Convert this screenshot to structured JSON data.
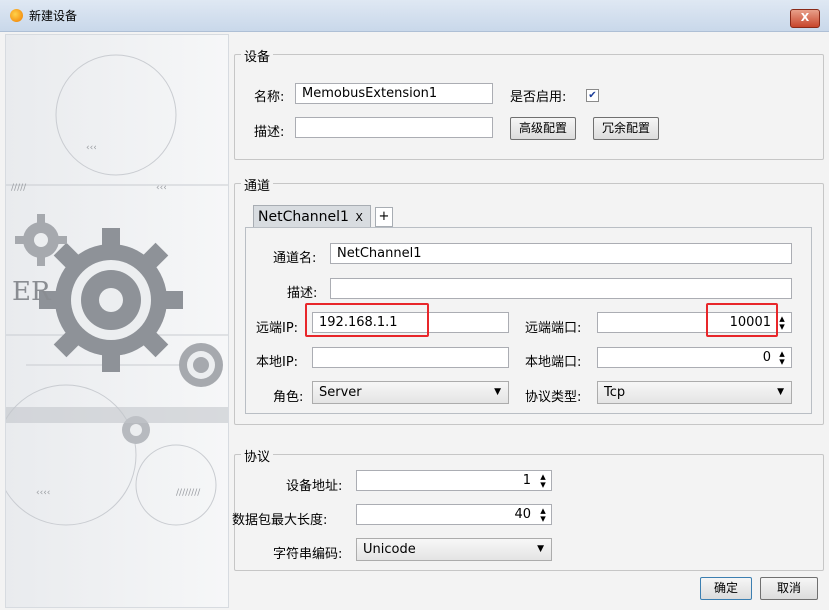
{
  "window": {
    "title": "新建设备",
    "close_label": "X"
  },
  "device": {
    "legend": "设备",
    "name_label": "名称:",
    "name_value": "MemobusExtension1",
    "enable_label": "是否启用:",
    "enabled": true,
    "desc_label": "描述:",
    "desc_value": "",
    "advanced_button": "高级配置",
    "redundancy_button": "冗余配置"
  },
  "channel": {
    "legend": "通道",
    "tabs": [
      {
        "label": "NetChannel1",
        "close": "X"
      }
    ],
    "add_tab": "+",
    "name_label": "通道名:",
    "name_value": "NetChannel1",
    "desc_label": "描述:",
    "desc_value": "",
    "remote_ip_label": "远端IP:",
    "remote_ip_value": "192.168.1.1",
    "remote_port_label": "远端端口:",
    "remote_port_value": "10001",
    "local_ip_label": "本地IP:",
    "local_ip_value": "",
    "local_port_label": "本地端口:",
    "local_port_value": "0",
    "role_label": "角色:",
    "role_value": "Server",
    "protocol_type_label": "协议类型:",
    "protocol_type_value": "Tcp"
  },
  "protocol": {
    "legend": "协议",
    "device_address_label": "设备地址:",
    "device_address_value": "1",
    "max_packet_label": "数据包最大长度:",
    "max_packet_value": "40",
    "encoding_label": "字符串编码:",
    "encoding_value": "Unicode"
  },
  "footer": {
    "ok_button": "确定",
    "cancel_button": "取消"
  },
  "art": {
    "label": "ER"
  },
  "colors": {
    "highlight": "#e8262a",
    "titlebar": "#c9d8ea"
  }
}
